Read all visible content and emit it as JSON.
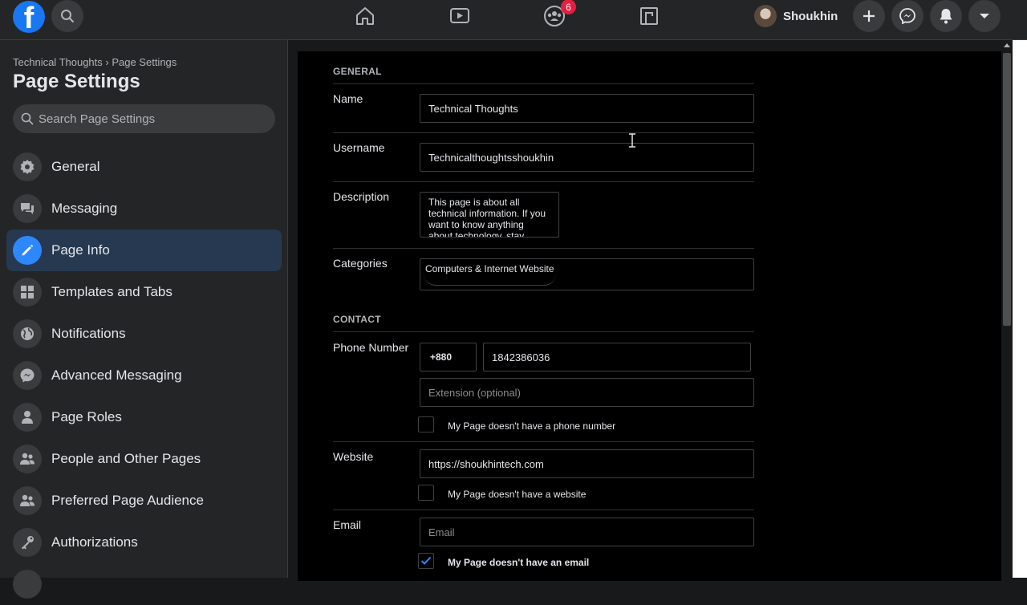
{
  "topbar": {
    "logo_letter": "f",
    "notification_badge": "6",
    "profile_name": "Shoukhin"
  },
  "sidebar": {
    "breadcrumb": "Technical Thoughts › Page Settings",
    "title": "Page Settings",
    "search_placeholder": "Search Page Settings",
    "items": [
      {
        "label": "General",
        "icon": "gear-icon"
      },
      {
        "label": "Messaging",
        "icon": "chat-icon"
      },
      {
        "label": "Page Info",
        "icon": "pencil-icon",
        "active": true
      },
      {
        "label": "Templates and Tabs",
        "icon": "grid-icon"
      },
      {
        "label": "Notifications",
        "icon": "globe-icon"
      },
      {
        "label": "Advanced Messaging",
        "icon": "messenger-icon"
      },
      {
        "label": "Page Roles",
        "icon": "person-icon"
      },
      {
        "label": "People and Other Pages",
        "icon": "people-icon"
      },
      {
        "label": "Preferred Page Audience",
        "icon": "people-icon"
      },
      {
        "label": "Authorizations",
        "icon": "key-icon"
      }
    ]
  },
  "form": {
    "general_heading": "GENERAL",
    "name_label": "Name",
    "name_value": "Technical Thoughts",
    "username_label": "Username",
    "username_value": "Technicalthoughtsshoukhin",
    "description_label": "Description",
    "description_value": "This page is about all technical information. If you want to know anything about technology, stay tuned with",
    "categories_label": "Categories",
    "category_value": "Computers & Internet Website",
    "contact_heading": "CONTACT",
    "phone_label": "Phone Number",
    "country_code": "+880",
    "phone_value": "1842386036",
    "extension_placeholder": "Extension (optional)",
    "no_phone_label": "My Page doesn't have a phone number",
    "no_phone_checked": false,
    "website_label": "Website",
    "website_value": "https://shoukhintech.com",
    "no_website_label": "My Page doesn't have a website",
    "no_website_checked": false,
    "email_label": "Email",
    "email_placeholder": "Email",
    "no_email_label": "My Page doesn't have an email",
    "no_email_checked": true
  },
  "colors": {
    "accent": "#2d88ff",
    "active_bg": "#263951",
    "badge": "#e41e3f"
  }
}
